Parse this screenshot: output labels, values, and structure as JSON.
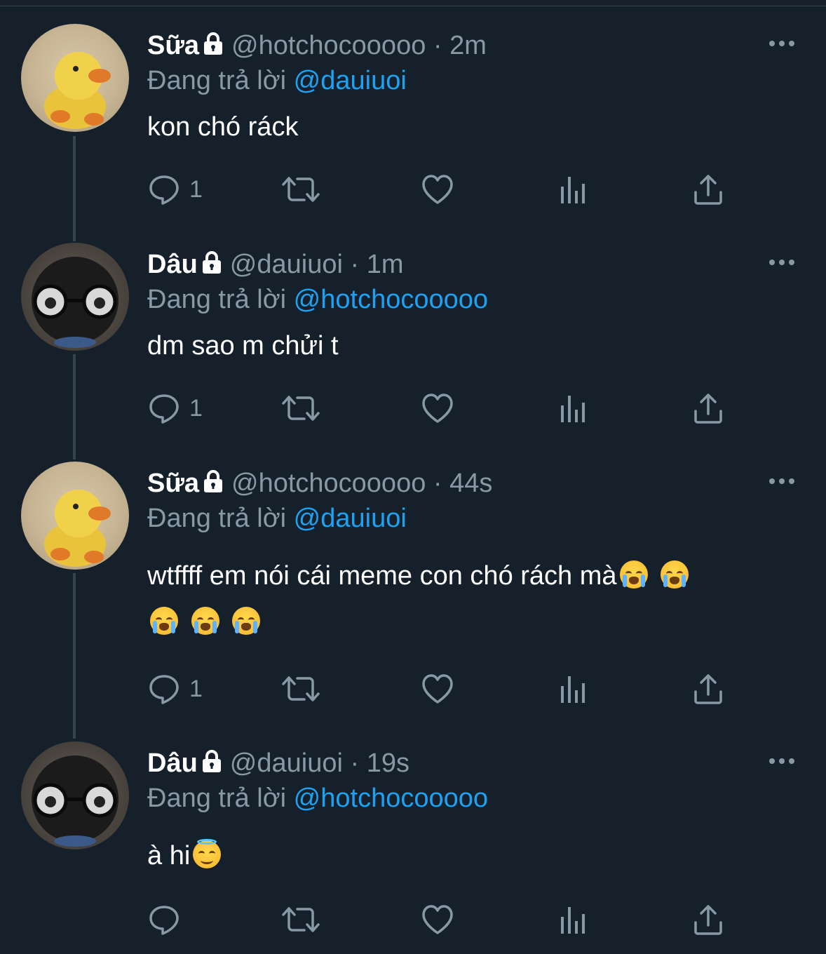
{
  "colors": {
    "background": "#15202b",
    "secondary_text": "#8899a6",
    "mention": "#1da1f2",
    "thread_line": "#38444d"
  },
  "tweets": [
    {
      "name": "Sữa",
      "handle": "@hotchocooooo",
      "time": "2m",
      "separator": "·",
      "replying_prefix": "Đang trả lời",
      "replying_to": "@dauiuoi",
      "text_line1": "kon chó ráck",
      "text_line2": "",
      "avatar": "duck-avatar",
      "reply_count": "1"
    },
    {
      "name": "Dâu",
      "handle": "@dauiuoi",
      "time": "1m",
      "separator": "·",
      "replying_prefix": "Đang trả lời",
      "replying_to": "@hotchocooooo",
      "text_line1": "dm sao m chửi t",
      "text_line2": "",
      "avatar": "bear-avatar",
      "reply_count": "1"
    },
    {
      "name": "Sữa",
      "handle": "@hotchocooooo",
      "time": "44s",
      "separator": "·",
      "replying_prefix": "Đang trả lời",
      "replying_to": "@dauiuoi",
      "text_line1": "wtffff em nói cái meme con chó rách mà",
      "text_line2": "",
      "avatar": "duck-avatar",
      "reply_count": "1",
      "emojis": [
        "loudly-crying-face",
        "loudly-crying-face",
        "loudly-crying-face",
        "loudly-crying-face",
        "loudly-crying-face"
      ]
    },
    {
      "name": "Dâu",
      "handle": "@dauiuoi",
      "time": "19s",
      "separator": "·",
      "replying_prefix": "Đang trả lời",
      "replying_to": "@hotchocooooo",
      "text_line1": "à hi",
      "text_line2": "",
      "avatar": "bear-avatar",
      "reply_count": "",
      "emojis": [
        "smiling-face-with-halo"
      ]
    }
  ],
  "icons": {
    "reply": "reply-icon",
    "retweet": "retweet-icon",
    "like": "like-icon",
    "analytics": "analytics-icon",
    "share": "share-icon",
    "more": "more-icon",
    "lock": "lock-icon"
  }
}
